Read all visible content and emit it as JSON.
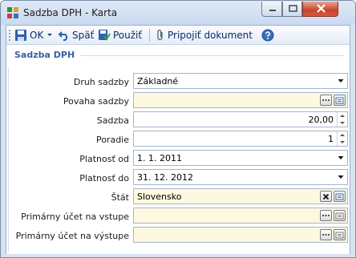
{
  "window": {
    "title": "Sadzba DPH - Karta"
  },
  "toolbar": {
    "ok_label": "OK",
    "back_label": "Späť",
    "apply_label": "Použiť",
    "attach_label": "Pripojiť dokument"
  },
  "group": {
    "title": "Sadzba DPH"
  },
  "form": {
    "druh_sadzby": {
      "label": "Druh sadzby",
      "value": "Základné"
    },
    "povaha_sadzby": {
      "label": "Povaha sadzby",
      "value": ""
    },
    "sadzba": {
      "label": "Sadzba",
      "value": "20,00"
    },
    "poradie": {
      "label": "Poradie",
      "value": "1"
    },
    "platnost_od": {
      "label": "Platnosť od",
      "value": "1. 1. 2011"
    },
    "platnost_do": {
      "label": "Platnosť do",
      "value": "31. 12. 2012"
    },
    "stat": {
      "label": "Štát",
      "value": "Slovensko"
    },
    "ucet_vstup": {
      "label": "Primárny účet na vstupe",
      "value": ""
    },
    "ucet_vystup": {
      "label": "Primárny účet na výstupe",
      "value": ""
    }
  },
  "colors": {
    "accent": "#3a5fa0",
    "required_bg": "#fdf8e0",
    "close_button": "#c7452b"
  },
  "icons": [
    "app-grid-icon",
    "minimize-icon",
    "maximize-icon",
    "close-icon",
    "save-icon",
    "undo-icon",
    "apply-icon",
    "paperclip-icon",
    "help-icon",
    "ellipsis-icon",
    "lookup-icon",
    "clear-icon",
    "chevron-down-icon",
    "spin-up-icon",
    "spin-down-icon"
  ]
}
